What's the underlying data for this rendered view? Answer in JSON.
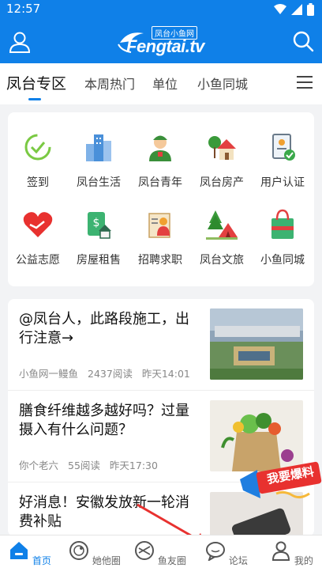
{
  "status_bar": {
    "time": "12:57"
  },
  "header": {
    "logo_cn": "凤台小鱼网",
    "logo_en": "Fengtai.tv"
  },
  "tabs": [
    {
      "label": "凤台专区",
      "active": true
    },
    {
      "label": "本周热门"
    },
    {
      "label": "单位"
    },
    {
      "label": "小鱼同城"
    }
  ],
  "grid": [
    {
      "label": "签到",
      "icon": "check-in-icon"
    },
    {
      "label": "凤台生活",
      "icon": "city-buildings-icon"
    },
    {
      "label": "凤台青年",
      "icon": "youth-person-icon"
    },
    {
      "label": "凤台房产",
      "icon": "house-icon"
    },
    {
      "label": "用户认证",
      "icon": "id-verify-icon"
    },
    {
      "label": "公益志愿",
      "icon": "heart-handshake-icon"
    },
    {
      "label": "房屋租售",
      "icon": "rent-house-icon"
    },
    {
      "label": "招聘求职",
      "icon": "recruit-icon"
    },
    {
      "label": "凤台文旅",
      "icon": "tent-icon"
    },
    {
      "label": "小鱼同城",
      "icon": "shopping-bag-icon"
    }
  ],
  "news": [
    {
      "title": "@凤台人，此路段施工，出行注意→",
      "source": "小鱼网一鳗鱼",
      "reads": "2437阅读",
      "time": "昨天14:01"
    },
    {
      "title": "膳食纤维越多越好吗？过量摄入有什么问题？",
      "source": "你个老六",
      "reads": "55阅读",
      "time": "昨天17:30"
    },
    {
      "title": "好消息！安徽发放新一轮消费补贴",
      "source": "",
      "reads": "",
      "time": ""
    }
  ],
  "promo": {
    "label": "我要爆料"
  },
  "bottom_nav": [
    {
      "label": "首页",
      "active": true
    },
    {
      "label": "她他圈"
    },
    {
      "label": "鱼友圈"
    },
    {
      "label": "论坛"
    },
    {
      "label": "我的"
    }
  ],
  "colors": {
    "brand_blue": "#0f80e8",
    "promo_red": "#e8312f"
  }
}
